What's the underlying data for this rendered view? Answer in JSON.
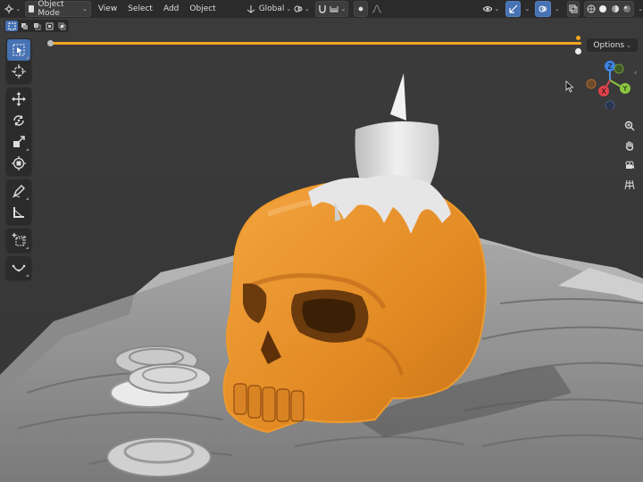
{
  "header": {
    "editor_type_icon": "3d-viewport-icon",
    "mode_label": "Object Mode",
    "menus": [
      "View",
      "Select",
      "Add",
      "Object"
    ],
    "transform_orientation": "Global",
    "snap_icon": "magnet-icon",
    "proportional_icon": "proportional-edit-icon",
    "overlay_icon": "overlay-icon",
    "shading_icons": [
      "wireframe-icon",
      "solid-icon",
      "material-preview-icon",
      "rendered-icon"
    ]
  },
  "viewport": {
    "options_label": "Options",
    "gizmo": {
      "z": "Z",
      "y": "Y",
      "x": "X"
    },
    "accent": "#f5a623",
    "selection_color": "#e8962e"
  },
  "toolbar": {
    "tools": [
      "select-box-icon",
      "cursor-icon",
      "move-icon",
      "rotate-icon",
      "scale-icon",
      "transform-icon",
      "annotate-icon",
      "measure-icon",
      "add-cube-icon",
      "curve-icon"
    ]
  },
  "nav": {
    "buttons": [
      "zoom-icon",
      "hand-pan-icon",
      "camera-icon",
      "grid-ortho-icon"
    ]
  }
}
